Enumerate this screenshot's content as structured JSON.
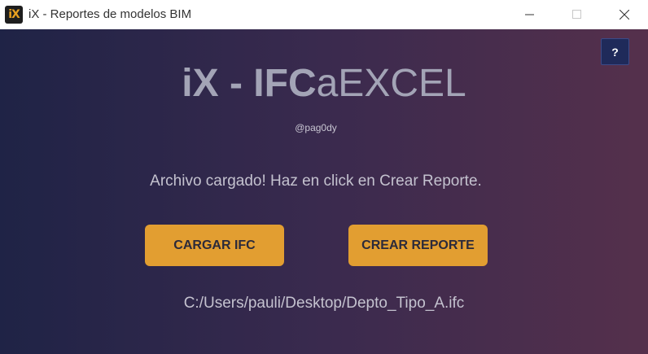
{
  "window": {
    "icon_text": "iX",
    "title": "iX - Reportes de modelos BIM"
  },
  "header": {
    "title_bold": "iX - IFC",
    "title_regular": "aEXCEL",
    "author": "@pag0dy"
  },
  "help": {
    "label": "?"
  },
  "status": {
    "message": "Archivo cargado! Haz en click en Crear Reporte."
  },
  "actions": {
    "load_label": "CARGAR IFC",
    "create_label": "CREAR REPORTE"
  },
  "file": {
    "path": "C:/Users/pauli/Desktop/Depto_Tipo_A.ifc"
  },
  "colors": {
    "accent": "#e29e31",
    "gradient_start": "#1f2346",
    "gradient_end": "#55304c",
    "help_button": "#1f2a5a"
  },
  "icons": {
    "minimize": "minimize-icon",
    "maximize": "maximize-icon",
    "close": "close-icon"
  }
}
